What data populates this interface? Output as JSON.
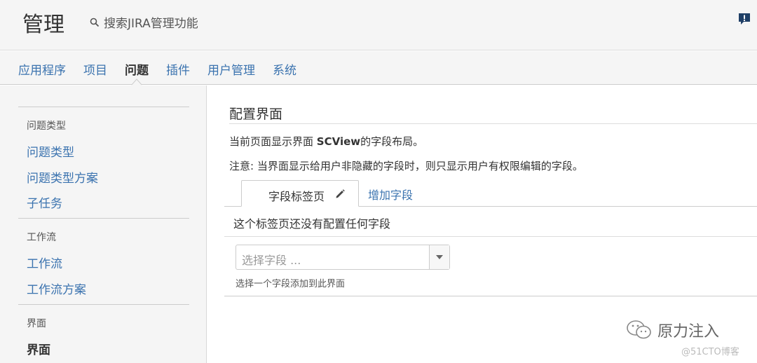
{
  "header": {
    "title": "管理",
    "search_placeholder": "搜索JIRA管理功能"
  },
  "nav": {
    "items": [
      {
        "label": "应用程序"
      },
      {
        "label": "项目"
      },
      {
        "label": "问题"
      },
      {
        "label": "插件"
      },
      {
        "label": "用户管理"
      },
      {
        "label": "系统"
      }
    ],
    "active": "问题"
  },
  "sidebar": {
    "sections": [
      {
        "heading": "问题类型",
        "links": [
          "问题类型",
          "问题类型方案",
          "子任务"
        ]
      },
      {
        "heading": "工作流",
        "links": [
          "工作流",
          "工作流方案"
        ]
      },
      {
        "heading": "界面",
        "links": [
          "界面"
        ]
      }
    ],
    "current": "界面"
  },
  "main": {
    "title": "配置界面",
    "desc_prefix": "当前页面显示界面 ",
    "screen_name": "SCView",
    "desc_suffix": "的字段布局。",
    "note": "注意: 当界面显示给用户非隐藏的字段时，则只显示用户有权限编辑的字段。",
    "tab_label": "字段标签页",
    "add_field_label": "增加字段",
    "empty_message": "这个标签页还没有配置任何字段",
    "select_placeholder": "选择字段 ...",
    "select_help": "选择一个字段添加到此界面"
  },
  "watermark": {
    "text": "原力注入",
    "sub": "@51CTO博客"
  },
  "colors": {
    "link": "#3b73af",
    "header_bg": "#f5f5f5",
    "feedback_icon": "#1f3f66"
  }
}
